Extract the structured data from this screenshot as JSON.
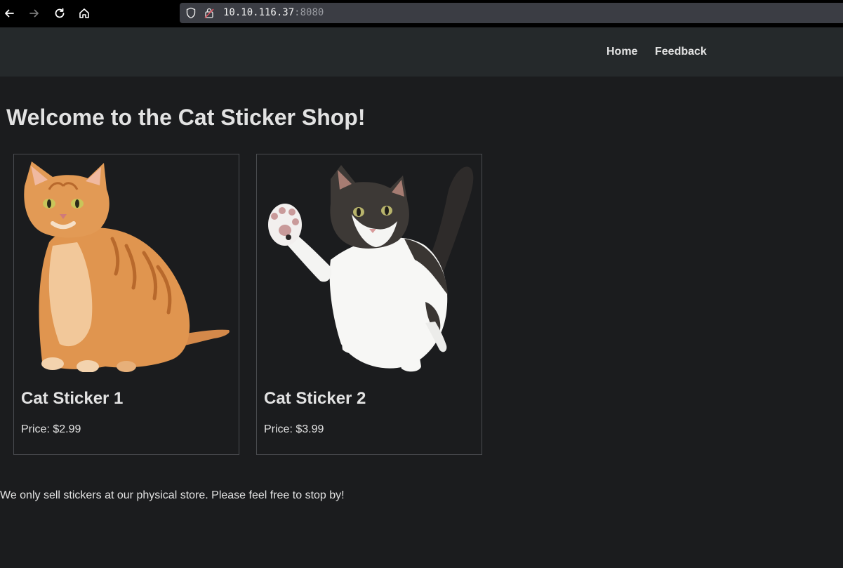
{
  "browser": {
    "url_host": "10.10.116.37",
    "url_port": ":8080",
    "buttons": [
      "back-icon",
      "forward-icon",
      "reload-icon",
      "home-icon"
    ]
  },
  "nav": {
    "home": "Home",
    "feedback": "Feedback"
  },
  "main": {
    "title": "Welcome to the Cat Sticker Shop!",
    "products": [
      {
        "name": "Cat Sticker 1",
        "price": "Price: $2.99",
        "image": "orange-tabby-cat-image"
      },
      {
        "name": "Cat Sticker 2",
        "price": "Price: $3.99",
        "image": "black-white-kitten-image"
      }
    ],
    "footer": "We only sell stickers at our physical store. Please feel free to stop by!"
  },
  "colors": {
    "page_bg": "#1b1c1e",
    "header_bg": "#25292b",
    "browser_bg": "#000000",
    "url_bg": "#3b3d44",
    "text": "#e2e2e2"
  }
}
